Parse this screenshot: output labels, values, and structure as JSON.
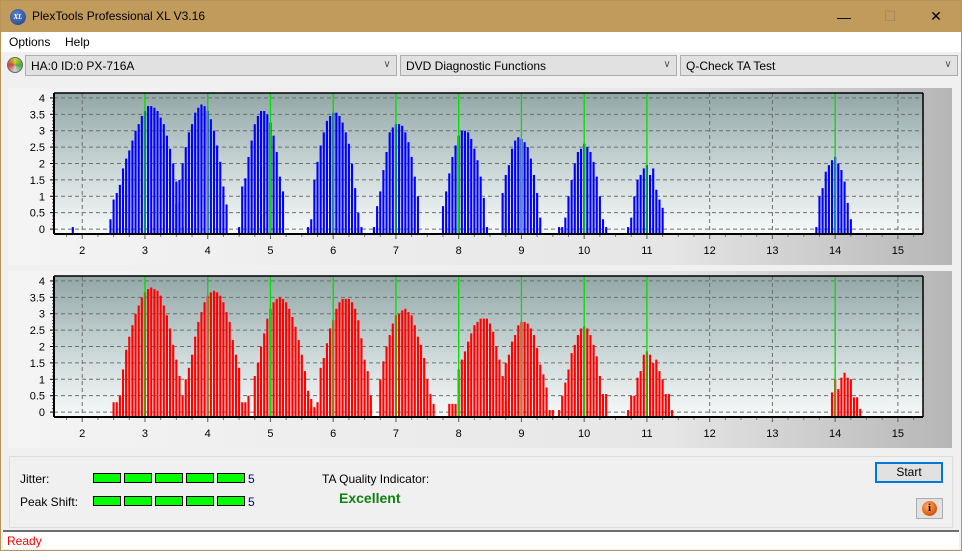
{
  "window": {
    "title": "PlexTools Professional XL V3.16",
    "icon_text": "XL",
    "controls": {
      "minimize": "—",
      "maximize": "☐",
      "close": "✕"
    }
  },
  "menu": [
    "Options",
    "Help"
  ],
  "toolbar": {
    "drive": "HA:0 ID:0  PX-716A",
    "function": "DVD Diagnostic Functions",
    "test": "Q-Check TA Test",
    "arrow": "∨"
  },
  "chart_data": [
    {
      "type": "bar",
      "name": "land-ta-distribution",
      "color": "#0000ff",
      "xlim": [
        1.55,
        15.4
      ],
      "ylim": [
        -0.15,
        4.15
      ],
      "x_ticks": [
        2,
        3,
        4,
        5,
        6,
        7,
        8,
        9,
        10,
        11,
        12,
        13,
        14,
        15
      ],
      "y_ticks": [
        "0",
        "0.5",
        "1",
        "1.5",
        "2",
        "2.5",
        "3",
        "3.5",
        "4"
      ],
      "y_tick_values": [
        0,
        0.5,
        1,
        1.5,
        2,
        2.5,
        3,
        3.5,
        4
      ],
      "reference_lines": [
        3,
        4,
        5,
        6,
        7,
        8,
        9,
        10,
        11,
        14
      ],
      "grid": true,
      "bar_step": 0.05,
      "peaks": [
        {
          "start": 1.85,
          "heights": [
            0
          ]
        },
        {
          "start": 2.45,
          "heights": [
            0.3,
            0.9,
            1.1,
            1.35,
            1.85,
            2.15,
            2.4,
            2.7,
            3.0,
            3.2,
            3.45,
            3.6,
            3.75,
            3.75,
            3.7,
            3.6,
            3.4,
            3.2,
            2.85,
            2.45,
            2.0,
            1.45,
            0.8,
            0.0
          ]
        },
        {
          "start": 3.5,
          "heights": [
            0.75,
            1.5,
            2.0,
            2.5,
            2.95,
            3.2,
            3.55,
            3.7,
            3.8,
            3.75,
            3.6,
            3.35,
            3.0,
            2.55,
            2.05,
            1.3,
            0.75
          ]
        },
        {
          "start": 4.5,
          "heights": [
            0,
            1.3,
            1.55,
            2.2,
            2.7,
            3.2,
            3.45,
            3.6,
            3.6,
            3.5,
            3.25,
            2.85,
            2.35,
            1.6,
            1.15
          ]
        },
        {
          "start": 5.6,
          "heights": [
            0,
            0.3,
            1.5,
            2.05,
            2.55,
            2.95,
            3.3,
            3.45,
            3.55,
            3.55,
            3.45,
            3.25,
            2.95,
            2.6,
            2.0,
            1.25,
            0.5,
            0.0
          ]
        },
        {
          "start": 6.65,
          "heights": [
            0,
            0.7,
            1.15,
            1.8,
            2.35,
            2.95,
            3.1,
            3.2,
            3.2,
            3.15,
            2.95,
            2.65,
            2.2,
            1.6,
            1.0
          ]
        },
        {
          "start": 7.75,
          "heights": [
            0.7,
            1.15,
            1.7,
            2.2,
            2.55,
            2.85,
            3.0,
            3.0,
            2.95,
            2.75,
            2.45,
            2.1,
            1.6,
            0.95,
            0.0
          ]
        },
        {
          "start": 8.7,
          "heights": [
            1.1,
            1.65,
            1.95,
            2.45,
            2.7,
            2.8,
            2.75,
            2.65,
            2.5,
            2.15,
            1.65,
            1.1,
            0.35
          ]
        },
        {
          "start": 9.6,
          "heights": [
            0,
            0,
            0.35,
            1.0,
            1.5,
            2.0,
            2.35,
            2.45,
            2.6,
            2.5,
            2.35,
            2.05,
            1.6,
            1.0,
            0.3,
            0.0
          ]
        },
        {
          "start": 10.7,
          "heights": [
            0,
            0.35,
            1.0,
            1.5,
            1.65,
            1.85,
            1.95,
            1.65,
            1.85,
            1.2,
            0.9,
            0.65
          ]
        },
        {
          "start": 13.7,
          "heights": [
            0,
            1.0,
            1.25,
            1.75,
            1.95,
            2.1,
            2.2,
            2.0,
            1.8,
            1.45,
            0.8,
            0.3
          ]
        }
      ]
    },
    {
      "type": "bar",
      "name": "pit-ta-distribution",
      "color": "#ff0000",
      "xlim": [
        1.55,
        15.4
      ],
      "ylim": [
        -0.15,
        4.15
      ],
      "x_ticks": [
        2,
        3,
        4,
        5,
        6,
        7,
        8,
        9,
        10,
        11,
        12,
        13,
        14,
        15
      ],
      "y_ticks": [
        "0",
        "0.5",
        "1",
        "1.5",
        "2",
        "2.5",
        "3",
        "3.5",
        "4"
      ],
      "y_tick_values": [
        0,
        0.5,
        1,
        1.5,
        2,
        2.5,
        3,
        3.5,
        4
      ],
      "reference_lines": [
        3,
        4,
        5,
        6,
        7,
        8,
        9,
        10,
        11,
        14
      ],
      "grid": true,
      "bar_step": 0.05,
      "peaks": [
        {
          "start": 2.5,
          "heights": [
            0.3,
            0.3,
            0.5,
            1.3,
            1.9,
            2.3,
            2.65,
            3.0,
            3.25,
            3.5,
            3.65,
            3.75,
            3.8,
            3.75,
            3.7,
            3.55,
            3.25,
            2.95,
            2.55,
            2.05,
            1.6,
            1.1,
            0.5
          ]
        },
        {
          "start": 3.65,
          "heights": [
            1.0,
            1.35,
            1.75,
            2.3,
            2.75,
            3.05,
            3.35,
            3.55,
            3.65,
            3.7,
            3.65,
            3.55,
            3.35,
            3.05,
            2.75,
            2.2,
            1.75,
            1.35,
            0.3,
            0.3,
            0.5
          ]
        },
        {
          "start": 4.75,
          "heights": [
            1.1,
            1.5,
            2.0,
            2.4,
            2.85,
            3.15,
            3.35,
            3.45,
            3.5,
            3.45,
            3.35,
            3.15,
            2.9,
            2.6,
            2.2,
            1.75,
            1.25,
            0.65,
            0.4
          ]
        },
        {
          "start": 5.65,
          "heights": [
            0.15,
            0.15,
            0.3,
            1.35,
            1.65,
            2.1,
            2.55,
            2.8,
            3.15,
            3.35,
            3.45,
            3.45,
            3.45,
            3.35,
            3.15,
            2.8,
            2.25,
            1.6,
            1.25,
            0.5
          ]
        },
        {
          "start": 6.75,
          "heights": [
            1.0,
            1.55,
            2.0,
            2.35,
            2.7,
            2.95,
            3.0,
            3.1,
            3.15,
            3.05,
            2.95,
            2.65,
            2.3,
            2.05,
            1.65,
            1.0,
            0.55,
            0.25
          ]
        },
        {
          "start": 7.85,
          "heights": [
            0.25,
            0.25,
            0.25,
            1.3,
            1.6,
            1.85,
            2.15,
            2.4,
            2.65,
            2.75,
            2.85,
            2.85,
            2.85,
            2.7,
            2.45,
            2.0,
            1.6,
            1.1,
            0.35,
            0.0
          ]
        },
        {
          "start": 8.7,
          "heights": [
            1.05,
            1.5,
            1.75,
            2.15,
            2.35,
            2.65,
            2.75,
            2.75,
            2.7,
            2.55,
            2.35,
            1.95,
            1.45,
            1.15,
            0.75,
            0.0,
            0.0
          ]
        },
        {
          "start": 9.6,
          "heights": [
            0,
            0.5,
            0.9,
            1.3,
            1.8,
            2.05,
            2.35,
            2.55,
            2.6,
            2.55,
            2.35,
            2.05,
            1.7,
            1.1,
            0.55,
            0.55
          ]
        },
        {
          "start": 10.7,
          "heights": [
            0,
            0.5,
            0.5,
            1.05,
            1.25,
            1.75,
            1.85,
            1.75,
            1.5,
            1.6,
            1.25,
            1.0,
            0.55,
            0.55,
            0.0
          ]
        },
        {
          "start": 13.95,
          "heights": [
            0.6,
            1.0,
            0.7,
            1.05,
            1.2,
            1.05,
            1.0,
            0.45,
            0.45,
            0.1
          ]
        }
      ]
    }
  ],
  "quality_panel": {
    "jitter_label": "Jitter:",
    "jitter_value": "5",
    "jitter_segments": 5,
    "peak_shift_label": "Peak Shift:",
    "peak_shift_value": "5",
    "peak_shift_segments": 5,
    "ta_label": "TA Quality Indicator:",
    "ta_value": "Excellent",
    "meter_color": "#00ff00",
    "quality_color": "#108010"
  },
  "buttons": {
    "start": "Start",
    "info": "i"
  },
  "status": {
    "text": "Ready",
    "color": "#ff0000"
  }
}
